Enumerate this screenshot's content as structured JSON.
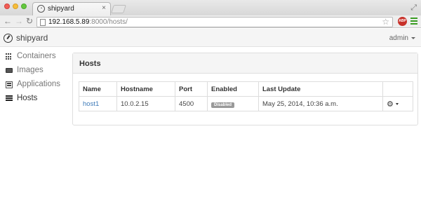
{
  "browser": {
    "tab_title": "shipyard",
    "tab_close": "×",
    "url_host": "192.168.5.89",
    "url_rest": ":8000/hosts/",
    "abp_label": "ABP"
  },
  "navbar": {
    "brand": "shipyard",
    "user": "admin"
  },
  "sidebar": {
    "items": [
      {
        "label": "Containers",
        "icon": "grid-icon"
      },
      {
        "label": "Images",
        "icon": "hdd-icon"
      },
      {
        "label": "Applications",
        "icon": "list-icon"
      },
      {
        "label": "Hosts",
        "icon": "tasks-icon"
      }
    ],
    "active": "Hosts"
  },
  "panel": {
    "title": "Hosts"
  },
  "table": {
    "headers": [
      "Name",
      "Hostname",
      "Port",
      "Enabled",
      "Last Update",
      ""
    ],
    "rows": [
      {
        "name": "host1",
        "hostname": "10.0.2.15",
        "port": "4500",
        "enabled": "Disabled",
        "last_update": "May 25, 2014, 10:36 a.m."
      }
    ]
  },
  "colors": {
    "link": "#3e7ab8",
    "badge": "#999999",
    "abp": "#c8312a",
    "menu": "#3a9d23"
  }
}
